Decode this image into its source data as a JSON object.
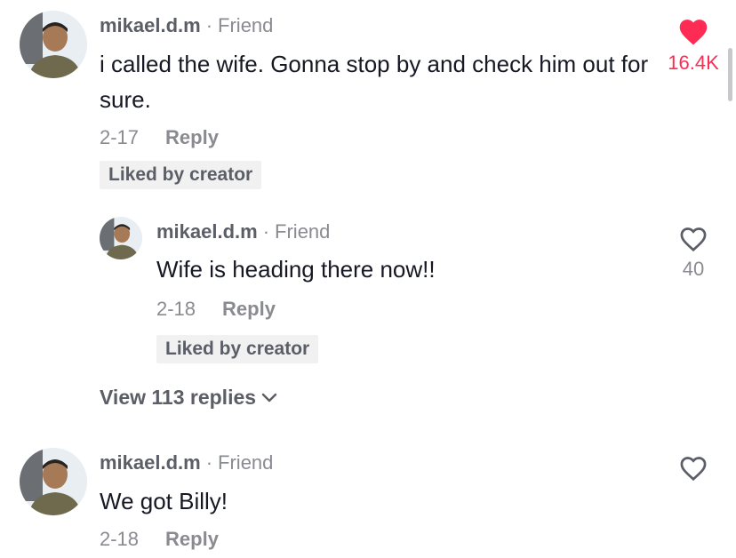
{
  "comments": [
    {
      "username": "mikael.d.m",
      "separator": "·",
      "relation": "Friend",
      "text": "i called the wife. Gonna stop by and check him out for sure.",
      "date": "2-17",
      "reply_label": "Reply",
      "liked_label": "Liked by creator",
      "likes": "16.4K",
      "liked": true
    },
    {
      "username": "mikael.d.m",
      "separator": "·",
      "relation": "Friend",
      "text": "Wife is heading there now!!",
      "date": "2-18",
      "reply_label": "Reply",
      "liked_label": "Liked by creator",
      "likes": "40",
      "liked": false
    },
    {
      "username": "mikael.d.m",
      "separator": "·",
      "relation": "Friend",
      "text": "We got Billy!",
      "date": "2-18",
      "reply_label": "Reply",
      "liked": false
    }
  ],
  "view_replies_label": "View 113 replies",
  "colors": {
    "accent": "#fe2c55",
    "muted": "#8a8b91",
    "text": "#161823"
  }
}
